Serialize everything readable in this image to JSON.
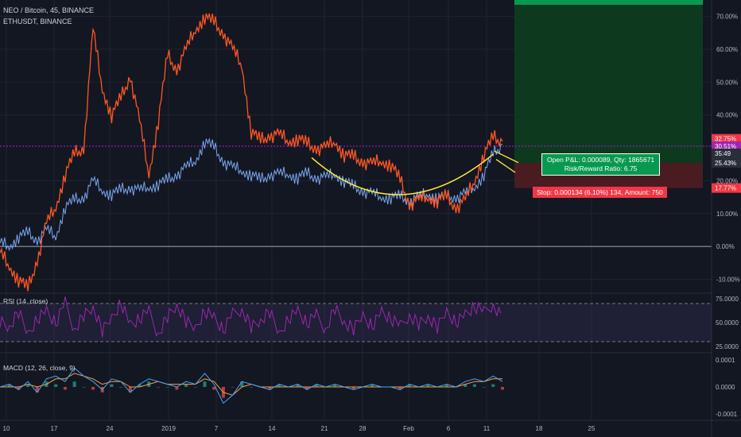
{
  "header": {
    "title": "NEO / Bitcoin, 45, BINANCE",
    "compare": "ETHUSDT, BINANCE"
  },
  "position": {
    "pnl_line1": "Open P&L: 0.000089, Qty: 1865671",
    "pnl_line2": "Risk/Reward Ratio: 6.75",
    "stop_text": "Stop: 0.000134 (6.10%) 134, Amount: 750"
  },
  "price_badges": [
    {
      "label": "32.75%",
      "color": "#f23645",
      "value": 32.75
    },
    {
      "label": "30.51%",
      "color": "#9c27b0",
      "value": 30.51
    },
    {
      "label": "35:49",
      "color": "#2a2e39",
      "value": 28.3
    },
    {
      "label": "25.43%",
      "color": "#2a2e39",
      "value": 25.43
    },
    {
      "label": "17.77%",
      "color": "#f23645",
      "value": 17.77
    }
  ],
  "indicators": {
    "rsi_title": "RSI (14, close)",
    "macd_title": "MACD (12, 26, close, 9)"
  },
  "colors": {
    "background": "#131722",
    "neo_series": "#ff5722",
    "eth_series": "#7aa6f0",
    "rsi_line": "#9c27b0",
    "macd_line": "#4ba3f5",
    "signal_line": "#f5a04b",
    "target_zone": "#0d3a1f",
    "stop_zone": "#4a1c22",
    "purple_level": "#7b1fa2",
    "curve": "#ffeb3b"
  },
  "chart_data": {
    "type": "line",
    "main_axis": {
      "unit": "%",
      "ylim": [
        -14,
        75
      ],
      "ticks": [
        70,
        60,
        50,
        40,
        20,
        10,
        0,
        -10
      ],
      "tick_labels": [
        "70.00%",
        "60.00%",
        "50.00%",
        "40.00%",
        "20.00%",
        "10.00%",
        "0.00%",
        "-10.00%"
      ]
    },
    "x_axis": {
      "tick_labels": [
        "10",
        "17",
        "24",
        "2019",
        "7",
        "14",
        "21",
        "28",
        "Feb",
        "6",
        "11",
        "18",
        "25"
      ]
    },
    "series": [
      {
        "name": "NEO / Bitcoin",
        "values": [
          -2,
          -6,
          -10,
          -13,
          -4,
          7,
          12,
          22,
          28,
          30,
          66,
          48,
          40,
          45,
          52,
          38,
          22,
          38,
          58,
          54,
          60,
          66,
          70,
          68,
          65,
          60,
          55,
          35,
          32,
          34,
          34,
          32,
          33,
          31,
          30,
          30,
          32,
          28,
          27,
          26,
          25,
          26,
          25,
          20,
          13,
          14,
          15,
          14,
          15,
          12,
          14,
          20,
          28,
          33,
          32
        ]
      },
      {
        "name": "ETHUSDT",
        "values": [
          1,
          0,
          3,
          4,
          2,
          5,
          3,
          12,
          14,
          15,
          20,
          17,
          16,
          17,
          18,
          17,
          18,
          19,
          20,
          22,
          24,
          26,
          32,
          30,
          26,
          24,
          23,
          22,
          20,
          22,
          22,
          22,
          21,
          22,
          21,
          21,
          22,
          20,
          18,
          17,
          16,
          15,
          15,
          15,
          14,
          15,
          16,
          15,
          15,
          15,
          16,
          18,
          22,
          28,
          31
        ]
      }
    ],
    "horizontal_lines": {
      "zero": 0,
      "purple_level": 30.51
    },
    "trade": {
      "entry": 25.43,
      "target_top": 75,
      "stop": 17.77
    },
    "rsi": {
      "ylim": [
        20,
        80
      ],
      "bands": [
        70,
        30
      ],
      "tick_labels": [
        "75.0000",
        "50.0000",
        "25.0000"
      ],
      "tick_values": [
        75,
        50,
        25
      ],
      "values": [
        52,
        45,
        60,
        38,
        55,
        62,
        48,
        70,
        44,
        58,
        66,
        40,
        55,
        72,
        47,
        53,
        61,
        39,
        57,
        68,
        50,
        44,
        63,
        55,
        41,
        58,
        65,
        46,
        52,
        60,
        38,
        55,
        62,
        48,
        57,
        44,
        66,
        50,
        42,
        58,
        47,
        61,
        53,
        45,
        59,
        49,
        56,
        44,
        62,
        51,
        58,
        66,
        60,
        70,
        55
      ]
    },
    "macd": {
      "ylim": [
        -0.00012,
        0.00012
      ],
      "tick_labels": [
        "0.0001",
        "0.0000",
        "-0.0001"
      ],
      "tick_values": [
        0.0001,
        0,
        -0.0001
      ],
      "macd": [
        0,
        1e-05,
        -1e-05,
        2e-05,
        -2e-05,
        3e-05,
        4e-05,
        2e-05,
        7e-05,
        4e-05,
        2e-05,
        -1e-05,
        3e-05,
        2e-05,
        -2e-05,
        1e-05,
        3e-05,
        2e-05,
        1e-05,
        0,
        2e-05,
        1e-05,
        5e-05,
        1e-05,
        -6e-05,
        -3e-05,
        2e-05,
        1e-05,
        0,
        -1e-05,
        1e-05,
        0,
        1e-05,
        -1e-05,
        1e-05,
        0,
        1e-05,
        0,
        -1e-05,
        0,
        1e-05,
        0,
        0,
        -1e-05,
        1e-05,
        0,
        1e-05,
        0,
        1e-05,
        0,
        2e-05,
        3e-05,
        2e-05,
        4e-05,
        2e-05
      ],
      "signal": [
        0,
        0,
        0,
        1e-05,
        0,
        1e-05,
        3e-05,
        3e-05,
        5e-05,
        4e-05,
        3e-05,
        1e-05,
        2e-05,
        2e-05,
        0,
        0,
        1e-05,
        2e-05,
        1e-05,
        1e-05,
        1e-05,
        1e-05,
        3e-05,
        2e-05,
        -2e-05,
        -3e-05,
        0,
        1e-05,
        0,
        0,
        0,
        0,
        0,
        0,
        0,
        0,
        0,
        0,
        0,
        0,
        0,
        0,
        0,
        0,
        0,
        0,
        0,
        0,
        0,
        0,
        1e-05,
        2e-05,
        2e-05,
        3e-05,
        3e-05
      ]
    }
  }
}
